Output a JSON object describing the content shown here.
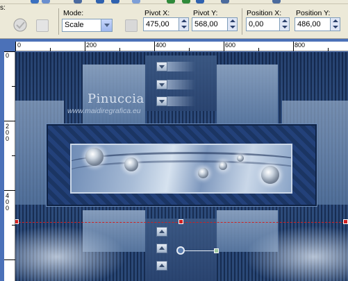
{
  "toolbar": {
    "left_stub": "s:",
    "mode_label": "Mode:",
    "mode_value": "Scale",
    "pivot_x_label": "Pivot X:",
    "pivot_x_value": "475,00",
    "pivot_y_label": "Pivot Y:",
    "pivot_y_value": "568,00",
    "position_x_label": "Position X:",
    "position_x_value": "0,00",
    "position_y_label": "Position Y:",
    "position_y_value": "486,00"
  },
  "ruler": {
    "h_labels": [
      "0",
      "200",
      "400",
      "600",
      "800"
    ],
    "v_labels": [
      "0",
      "200",
      "400"
    ]
  },
  "canvas": {
    "watermark_title": "Pinuccia",
    "watermark_url": "www.maidiregrafica.eu"
  },
  "colors": {
    "accent": "#4b71b8",
    "guide": "#d02020"
  }
}
